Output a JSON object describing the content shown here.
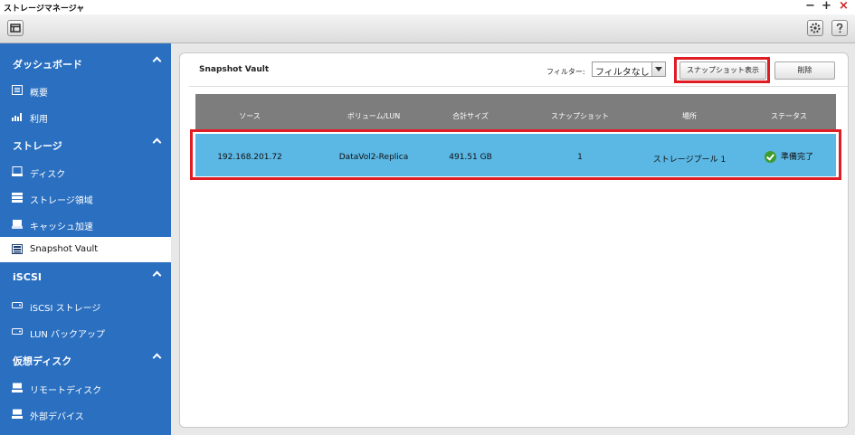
{
  "window": {
    "title": "ストレージマネージャ",
    "controls": [
      "−",
      "+",
      "×"
    ]
  },
  "sidebar": {
    "sections": [
      {
        "label": "ダッシュボード",
        "items": [
          {
            "label": "概要",
            "icon": "overview-icon"
          },
          {
            "label": "利用",
            "icon": "usage-chart-icon"
          }
        ]
      },
      {
        "label": "ストレージ",
        "items": [
          {
            "label": "ディスク",
            "icon": "disk-icon"
          },
          {
            "label": "ストレージ領域",
            "icon": "storage-space-icon"
          },
          {
            "label": "キャッシュ加速",
            "icon": "cache-icon"
          },
          {
            "label": "Snapshot Vault",
            "icon": "snapshot-vault-icon",
            "active": true
          }
        ]
      },
      {
        "label": "iSCSI",
        "items": [
          {
            "label": "iSCSI ストレージ",
            "icon": "iscsi-storage-icon"
          },
          {
            "label": "LUN バックアップ",
            "icon": "lun-backup-icon"
          }
        ]
      },
      {
        "label": "仮想ディスク",
        "items": [
          {
            "label": "リモートディスク",
            "icon": "remote-disk-icon"
          },
          {
            "label": "外部デバイス",
            "icon": "external-device-icon"
          }
        ]
      }
    ]
  },
  "main": {
    "title": "Snapshot Vault",
    "filter_label": "フィルター:",
    "filter_value": "フィルタなし",
    "show_snapshot_label": "スナップショット表示",
    "delete_label": "削除",
    "columns": [
      "ソース",
      "ボリューム/LUN",
      "合計サイズ",
      "スナップショット",
      "場所",
      "ステータス"
    ],
    "rows": [
      [
        "192.168.201.72",
        "DataVol2-Replica",
        "491.51 GB",
        "1",
        "ストレージプール 1",
        "準備完了"
      ]
    ]
  },
  "colors": {
    "sidebar": "#2a6fc0",
    "selected_row": "#5bb7e4",
    "highlight": "#e01c24",
    "status_ok": "#3f9b2d"
  }
}
